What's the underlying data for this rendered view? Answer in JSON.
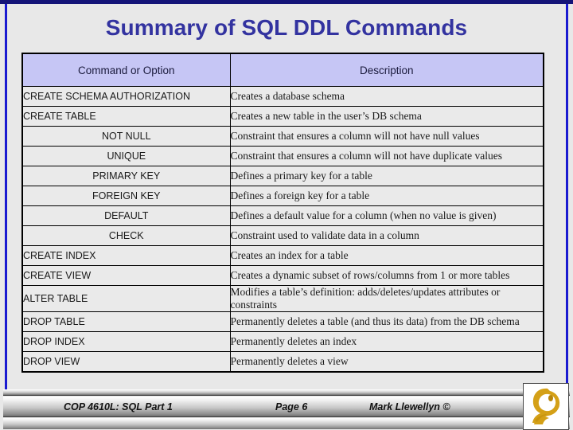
{
  "slide": {
    "title": "Summary of SQL DDL Commands",
    "title_color": "#3333a0",
    "background_color": "#e8e8e8",
    "border_color": "#1a1ad0",
    "header_fill": "#c6c6f5"
  },
  "table": {
    "headers": {
      "command": "Command or Option",
      "description": "Description"
    },
    "rows": [
      {
        "command": "CREATE SCHEMA AUTHORIZATION",
        "align": "left",
        "description": "Creates a database schema",
        "tall": false
      },
      {
        "command": "CREATE TABLE",
        "align": "left",
        "description": "Creates a new table in the user’s DB schema",
        "tall": false
      },
      {
        "command": "NOT NULL",
        "align": "center",
        "description": "Constraint that ensures a column will not have null values",
        "tall": false
      },
      {
        "command": "UNIQUE",
        "align": "center",
        "description": "Constraint that ensures a column will not have duplicate values",
        "tall": false
      },
      {
        "command": "PRIMARY KEY",
        "align": "center",
        "description": "Defines a primary key for a table",
        "tall": false
      },
      {
        "command": "FOREIGN KEY",
        "align": "center",
        "description": "Defines a foreign key for a table",
        "tall": false
      },
      {
        "command": "DEFAULT",
        "align": "center",
        "description": "Defines a default value for a column (when no value is given)",
        "tall": false
      },
      {
        "command": "CHECK",
        "align": "center",
        "description": "Constraint used to validate data in a column",
        "tall": false
      },
      {
        "command": "CREATE INDEX",
        "align": "left",
        "description": "Creates an index for a table",
        "tall": false
      },
      {
        "command": "CREATE VIEW",
        "align": "left",
        "description": "Creates a dynamic subset of rows/columns from 1 or more tables",
        "tall": false
      },
      {
        "command": "ALTER TABLE",
        "align": "left",
        "description": "Modifies a table’s definition: adds/deletes/updates attributes or constraints",
        "tall": true
      },
      {
        "command": "DROP TABLE",
        "align": "left",
        "description": "Permanently deletes a table (and thus its data) from the DB schema",
        "tall": true
      },
      {
        "command": "DROP INDEX",
        "align": "left",
        "description": "Permanently deletes an index",
        "tall": false
      },
      {
        "command": "DROP VIEW",
        "align": "left",
        "description": "Permanently deletes a view",
        "tall": false
      }
    ]
  },
  "footer": {
    "course": "COP 4610L: SQL Part 1",
    "page": "Page 6",
    "author": "Mark Llewellyn ©",
    "logo_name": "ucf-pegasus-logo",
    "logo_color": "#d4a017"
  }
}
